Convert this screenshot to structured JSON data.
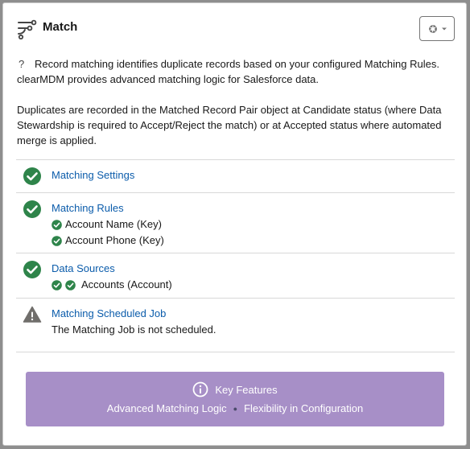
{
  "header": {
    "title": "Match",
    "icon": "flow-icon",
    "settings_icon": "gear-icon"
  },
  "description": {
    "help_icon": "?",
    "paragraph1": "Record matching identifies duplicate records based on your configured Matching Rules. clearMDM provides advanced matching logic for Salesforce data.",
    "paragraph2": "Duplicates are recorded in the Matched Record Pair object at Candidate status (where Data Stewardship is required to Accept/Reject the match) or at Accepted status where automated merge is applied."
  },
  "items": [
    {
      "title": "Matching Settings",
      "status": "success"
    },
    {
      "title": "Matching Rules",
      "status": "success",
      "sub": [
        "Account Name (Key)",
        "Account Phone (Key)"
      ]
    },
    {
      "title": "Data Sources",
      "status": "success",
      "sub": [
        "Accounts (Account)"
      ]
    },
    {
      "title": "Matching Scheduled Job",
      "status": "warning",
      "note": "The Matching Job is not scheduled."
    }
  ],
  "banner": {
    "title": "Key Features",
    "features": [
      "Advanced Matching Logic",
      "Flexibility in Configuration"
    ]
  },
  "colors": {
    "success": "#2e844a",
    "warning": "#706e6b",
    "link": "#0b5cab",
    "banner": "#a78fc7"
  }
}
